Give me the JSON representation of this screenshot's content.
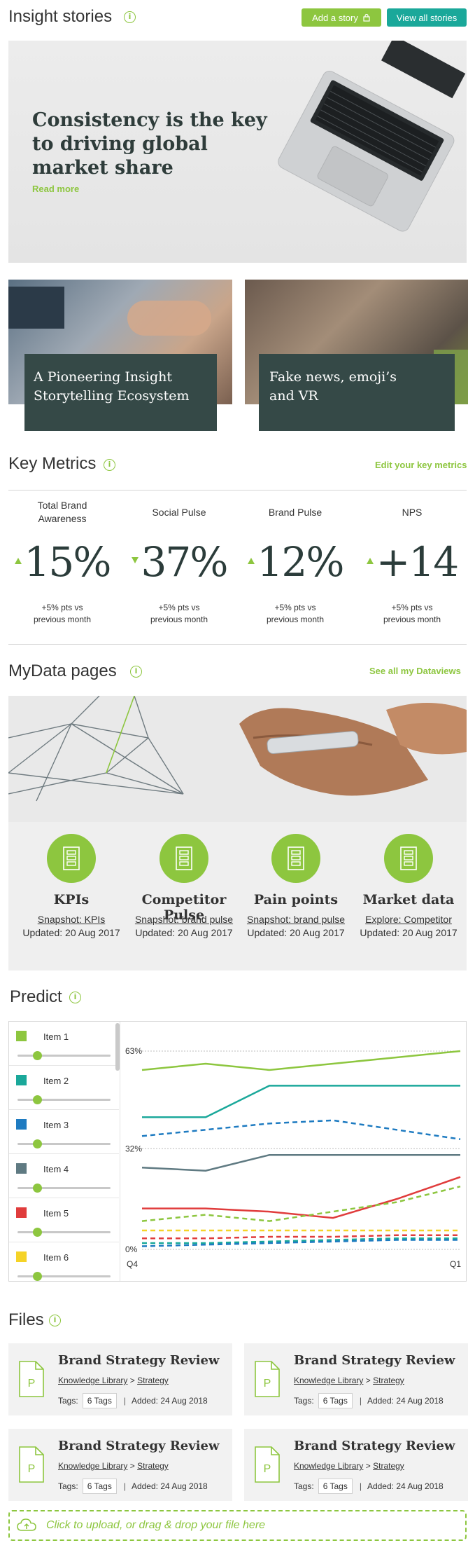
{
  "insight": {
    "title": "Insight stories",
    "info": "i",
    "add_story": "Add a story",
    "view_all": "View all stories",
    "hero_title_l1": "Consistency is the key",
    "hero_title_l2": "to driving global",
    "hero_title_l3": "market share",
    "read_more": "Read more",
    "card1_l1": "A Pioneering Insight",
    "card1_l2": "Storytelling Ecosystem",
    "card2_l1": "Fake news, emoji’s",
    "card2_l2": "and VR"
  },
  "metrics": {
    "title": "Key Metrics",
    "edit": "Edit your key metrics",
    "items": [
      {
        "label_l1": "Total Brand",
        "label_l2": "Awareness",
        "value": "15%",
        "direction": "up",
        "sub_l1": "+5% pts vs",
        "sub_l2": "previous month"
      },
      {
        "label_l1": "Social Pulse",
        "label_l2": "",
        "value": "37%",
        "direction": "down",
        "sub_l1": "+5% pts vs",
        "sub_l2": "previous month"
      },
      {
        "label_l1": "Brand Pulse",
        "label_l2": "",
        "value": "12%",
        "direction": "up",
        "sub_l1": "+5% pts vs",
        "sub_l2": "previous month"
      },
      {
        "label_l1": "NPS",
        "label_l2": "",
        "value": "+14",
        "direction": "up",
        "sub_l1": "+5% pts vs",
        "sub_l2": "previous month"
      }
    ]
  },
  "mydata": {
    "title": "MyData pages",
    "see_all": "See all my Dataviews",
    "items": [
      {
        "title": "KPIs",
        "link": "Snapshot: KPIs",
        "updated": "Updated: 20 Aug 2017"
      },
      {
        "title": "Competitor Pulse",
        "link": "Snapshot: brand pulse",
        "updated": "Updated: 20 Aug 2017"
      },
      {
        "title": "Pain points",
        "link": "Snapshot: brand pulse",
        "updated": "Updated: 20 Aug 2017"
      },
      {
        "title": "Market data",
        "link": "Explore: Competitor",
        "updated": "Updated: 20 Aug 2017"
      }
    ]
  },
  "predict": {
    "title": "Predict",
    "items": [
      {
        "label": "Item 1",
        "color": "#8dc63f"
      },
      {
        "label": "Item 2",
        "color": "#1aa89a"
      },
      {
        "label": "Item 3",
        "color": "#1e7bc1"
      },
      {
        "label": "Item 4",
        "color": "#5f7a82"
      },
      {
        "label": "Item 5",
        "color": "#e03c3c"
      },
      {
        "label": "Item 6",
        "color": "#f5d327"
      }
    ]
  },
  "chart_data": {
    "type": "line",
    "x": [
      "Q4",
      "",
      "",
      "",
      "",
      "Q1"
    ],
    "y_ticks": [
      "63%",
      "32%",
      "0%"
    ],
    "ylim": [
      0,
      63
    ],
    "series": [
      {
        "color": "#8dc63f",
        "style": "solid",
        "values": [
          57,
          59,
          57,
          59,
          61,
          63
        ]
      },
      {
        "color": "#1aa89a",
        "style": "solid",
        "values": [
          42,
          42,
          52,
          52,
          52,
          52
        ]
      },
      {
        "color": "#1e7bc1",
        "style": "dashed",
        "values": [
          36,
          38,
          40,
          41,
          38,
          35
        ]
      },
      {
        "color": "#5f7a82",
        "style": "solid",
        "values": [
          26,
          25,
          30,
          30,
          30,
          30
        ]
      },
      {
        "color": "#e03c3c",
        "style": "solid",
        "values": [
          13,
          13,
          12,
          10,
          16,
          23
        ]
      },
      {
        "color": "#8dc63f",
        "style": "dashed",
        "values": [
          9,
          11,
          9,
          12,
          15,
          20
        ]
      },
      {
        "color": "#f5d327",
        "style": "dashed",
        "values": [
          6,
          6,
          6,
          6,
          6,
          6
        ]
      },
      {
        "color": "#e03c3c",
        "style": "dashed",
        "values": [
          3.5,
          3.5,
          4,
          4,
          4.5,
          4.5
        ]
      },
      {
        "color": "#1aa89a",
        "style": "dashed",
        "values": [
          2,
          2,
          2.5,
          3,
          3.5,
          3.5
        ]
      },
      {
        "color": "#1e7bc1",
        "style": "dashed",
        "values": [
          1,
          1.5,
          2,
          2.5,
          3,
          3
        ]
      }
    ]
  },
  "files": {
    "title": "Files",
    "cards": [
      {
        "title": "Brand Strategy Review",
        "path1": "Knowledge Library",
        "sep": ">",
        "path2": "Strategy",
        "tags_label": "Tags:",
        "tags": "6 Tags",
        "added": "Added: 24 Aug 2018"
      },
      {
        "title": "Brand Strategy Review",
        "path1": "Knowledge Library",
        "sep": ">",
        "path2": "Strategy",
        "tags_label": "Tags:",
        "tags": "6 Tags",
        "added": "Added: 24 Aug 2018"
      },
      {
        "title": "Brand Strategy Review",
        "path1": "Knowledge Library",
        "sep": ">",
        "path2": "Strategy",
        "tags_label": "Tags:",
        "tags": "6 Tags",
        "added": "Added: 24 Aug 2018"
      },
      {
        "title": "Brand Strategy Review",
        "path1": "Knowledge Library",
        "sep": ">",
        "path2": "Strategy",
        "tags_label": "Tags:",
        "tags": "6 Tags",
        "added": "Added: 24 Aug 2018"
      }
    ],
    "file_letter": "P",
    "upload": "Click to upload, or drag & drop your file here"
  }
}
